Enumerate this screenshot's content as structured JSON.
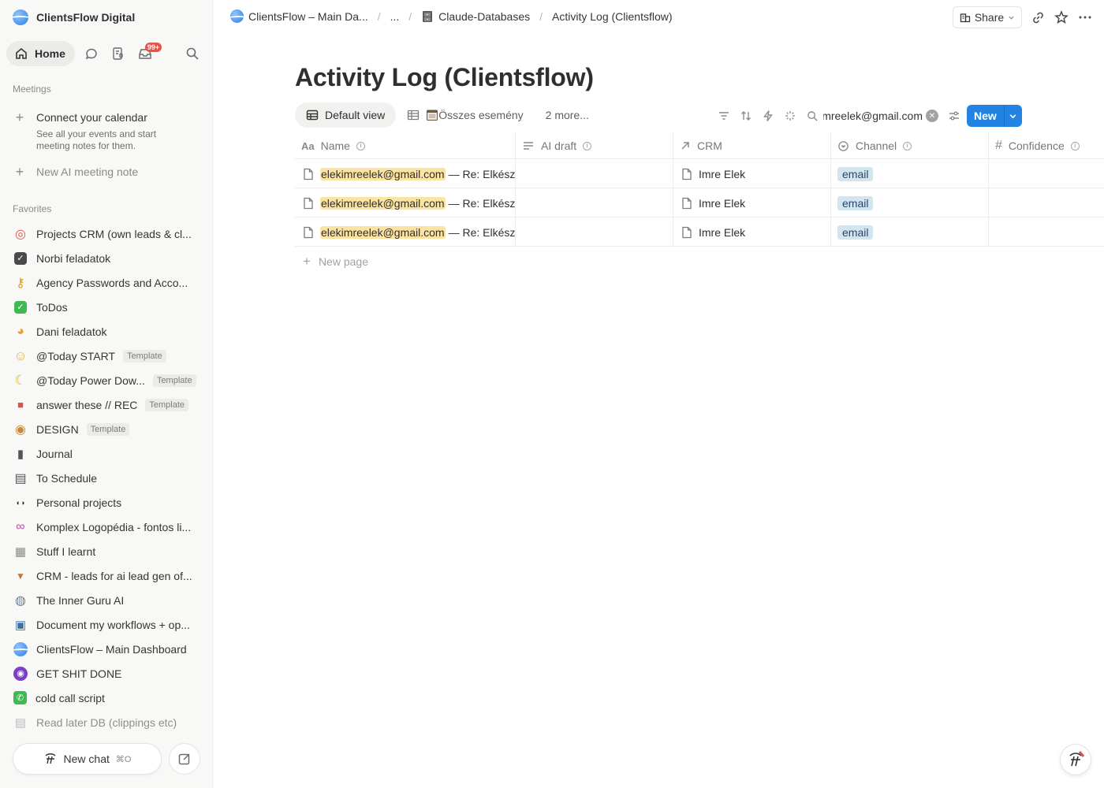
{
  "workspace": {
    "name": "ClientsFlow Digital"
  },
  "nav": {
    "home_label": "Home",
    "inbox_badge": "99+"
  },
  "meetings": {
    "section_label": "Meetings",
    "connect_title": "Connect your calendar",
    "connect_desc": "See all your events and start meeting notes for them.",
    "new_note_label": "New AI meeting note"
  },
  "favorites": {
    "section_label": "Favorites",
    "items": [
      {
        "label": "Projects CRM (own leads & cl...",
        "icon": "target-icon",
        "template": ""
      },
      {
        "label": "Norbi feladatok",
        "icon": "checkbox-icon",
        "template": ""
      },
      {
        "label": "Agency Passwords and Acco...",
        "icon": "key-icon",
        "template": ""
      },
      {
        "label": "ToDos",
        "icon": "check-mark-icon",
        "template": ""
      },
      {
        "label": "Dani feladatok",
        "icon": "cat-icon",
        "template": ""
      },
      {
        "label": "@Today START",
        "icon": "smiley-icon",
        "template": "Template"
      },
      {
        "label": "@Today Power Dow...",
        "icon": "moon-icon",
        "template": "Template"
      },
      {
        "label": "answer these // REC",
        "icon": "video-camera-icon",
        "template": "Template"
      },
      {
        "label": "DESIGN",
        "icon": "palette-icon",
        "template": "Template"
      },
      {
        "label": "Journal",
        "icon": "notebook-icon",
        "template": ""
      },
      {
        "label": "To Schedule",
        "icon": "ledger-icon",
        "template": ""
      },
      {
        "label": "Personal projects",
        "icon": "sunglasses-icon",
        "template": ""
      },
      {
        "label": "Komplex Logopédia - fontos li...",
        "icon": "link-icon",
        "template": ""
      },
      {
        "label": "Stuff I learnt",
        "icon": "table-icon",
        "template": ""
      },
      {
        "label": "CRM - leads for ai lead gen of...",
        "icon": "inbox-tray-icon",
        "template": ""
      },
      {
        "label": "The Inner Guru AI",
        "icon": "robot-icon",
        "template": ""
      },
      {
        "label": "Document my workflows + op...",
        "icon": "chip-icon",
        "template": ""
      },
      {
        "label": "ClientsFlow – Main Dashboard",
        "icon": "clientsflow-logo-icon",
        "template": ""
      },
      {
        "label": "GET SHIT DONE",
        "icon": "purple-eye-icon",
        "template": ""
      },
      {
        "label": "cold call script",
        "icon": "phone-icon",
        "template": ""
      },
      {
        "label": "Read later DB (clippings etc)",
        "icon": "page-icon",
        "template": ""
      }
    ]
  },
  "chat": {
    "new_chat_label": "New chat",
    "shortcut": "⌘O"
  },
  "breadcrumbs": {
    "root": "ClientsFlow – Main Da...",
    "ellipsis": "...",
    "parent": "Claude-Databases",
    "current": "Activity Log (Clientsflow)"
  },
  "topbar": {
    "share_label": "Share"
  },
  "page": {
    "title": "Activity Log (Clientsflow)"
  },
  "views": {
    "default_label": "Default view",
    "second_label": "Összes esemény",
    "more_label": "2 more..."
  },
  "search": {
    "value": "elekimreelek@gmail.com"
  },
  "new_button": {
    "label": "New"
  },
  "table": {
    "columns": [
      "Name",
      "AI draft",
      "CRM",
      "Channel",
      "Confidence"
    ],
    "rows": [
      {
        "name_highlight": "elekimreelek@gmail.com",
        "name_rest": "— Re: Elkészült",
        "ai_draft": "",
        "crm": "Imre Elek",
        "channel": "email",
        "confidence": ""
      },
      {
        "name_highlight": "elekimreelek@gmail.com",
        "name_rest": "— Re: Elkészült",
        "ai_draft": "",
        "crm": "Imre Elek",
        "channel": "email",
        "confidence": ""
      },
      {
        "name_highlight": "elekimreelek@gmail.com",
        "name_rest": "— Re: Elkészült",
        "ai_draft": "",
        "crm": "Imre Elek",
        "channel": "email",
        "confidence": ""
      }
    ],
    "new_page_label": "New page"
  },
  "colors": {
    "accent": "#2383e2",
    "highlight": "#fbe4a2",
    "tag_bg": "#d3e5ef",
    "badge": "#e5534b"
  }
}
